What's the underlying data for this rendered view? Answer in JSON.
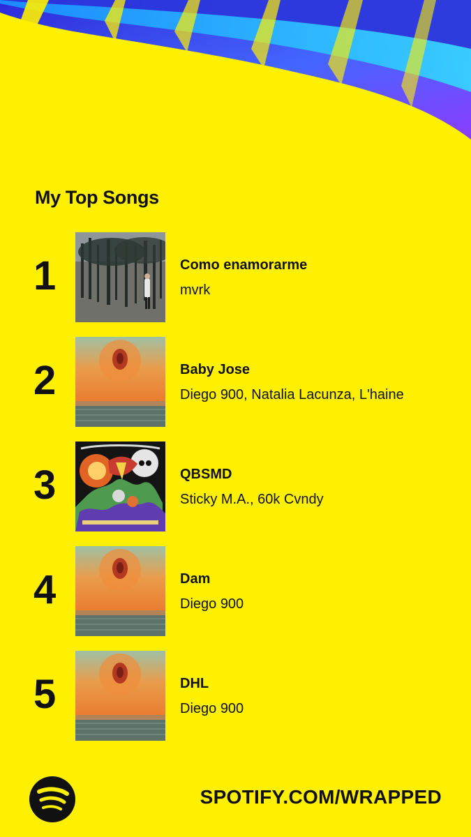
{
  "page": {
    "title": "My Top Songs",
    "background_color": "#FFF000",
    "accent_colors": [
      "#2E2BD9",
      "#7C3AED",
      "#1E9BE9",
      "#8B3DFF"
    ]
  },
  "songs": [
    {
      "rank": "1",
      "title": "Como enamorarme",
      "artist": "mvrk",
      "cover_icon": "forest-album-cover"
    },
    {
      "rank": "2",
      "title": "Baby Jose",
      "artist": "Diego 900, Natalia Lacunza, L'haine",
      "cover_icon": "sunset-sea-album-cover"
    },
    {
      "rank": "3",
      "title": "QBSMD",
      "artist": "Sticky M.A., 60k Cvndy",
      "cover_icon": "illustrated-album-cover"
    },
    {
      "rank": "4",
      "title": "Dam",
      "artist": "Diego 900",
      "cover_icon": "sunset-sea-album-cover"
    },
    {
      "rank": "5",
      "title": "DHL",
      "artist": "Diego 900",
      "cover_icon": "sunset-sea-album-cover"
    }
  ],
  "footer": {
    "logo_icon": "spotify-logo-icon",
    "url": "SPOTIFY.COM/WRAPPED"
  }
}
